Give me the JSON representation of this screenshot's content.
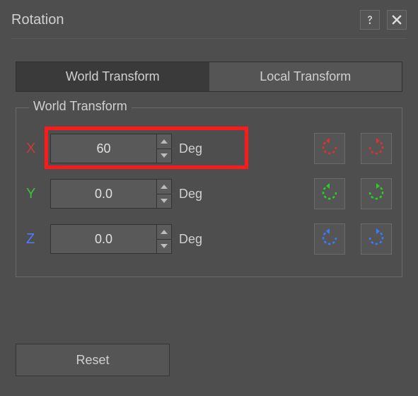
{
  "header": {
    "title": "Rotation"
  },
  "tabs": {
    "world": "World Transform",
    "local": "Local Transform",
    "active": "world"
  },
  "group": {
    "label": "World Transform"
  },
  "axes": {
    "x": {
      "label": "X",
      "value": "60",
      "unit": "Deg",
      "color": "#c53c3c"
    },
    "y": {
      "label": "Y",
      "value": "0.0",
      "unit": "Deg",
      "color": "#3fbf3f"
    },
    "z": {
      "label": "Z",
      "value": "0.0",
      "unit": "Deg",
      "color": "#4d7dff"
    }
  },
  "buttons": {
    "reset": "Reset"
  }
}
